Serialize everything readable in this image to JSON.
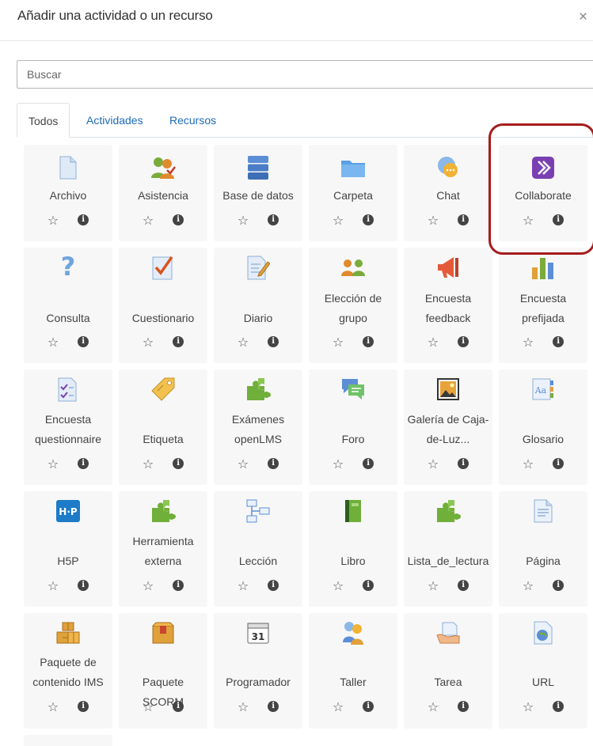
{
  "modal": {
    "title": "Añadir una actividad o un recurso",
    "close": "×"
  },
  "search": {
    "placeholder": "Buscar"
  },
  "tabs": [
    {
      "label": "Todos"
    },
    {
      "label": "Actividades"
    },
    {
      "label": "Recursos"
    }
  ],
  "items": [
    {
      "label": "Archivo",
      "icon": "file-icon"
    },
    {
      "label": "Asistencia",
      "icon": "attendance-icon"
    },
    {
      "label": "Base de datos",
      "icon": "database-icon"
    },
    {
      "label": "Carpeta",
      "icon": "folder-icon"
    },
    {
      "label": "Chat",
      "icon": "chat-icon"
    },
    {
      "label": "Collaborate",
      "icon": "collaborate-icon"
    },
    {
      "label": "Consulta",
      "icon": "question-icon"
    },
    {
      "label": "Cuestionario",
      "icon": "quiz-icon"
    },
    {
      "label": "Diario",
      "icon": "journal-icon"
    },
    {
      "label": "Elección de grupo",
      "icon": "group-choice-icon"
    },
    {
      "label": "Encuesta feedback",
      "icon": "feedback-icon"
    },
    {
      "label": "Encuesta prefijada",
      "icon": "survey-icon"
    },
    {
      "label": "Encuesta questionnaire",
      "icon": "questionnaire-icon"
    },
    {
      "label": "Etiqueta",
      "icon": "label-icon"
    },
    {
      "label": "Exámenes openLMS",
      "icon": "puzzle-icon"
    },
    {
      "label": "Foro",
      "icon": "forum-icon"
    },
    {
      "label": "Galería de Caja-de-Luz...",
      "icon": "gallery-icon"
    },
    {
      "label": "Glosario",
      "icon": "glossary-icon"
    },
    {
      "label": "H5P",
      "icon": "h5p-icon"
    },
    {
      "label": "Herramienta externa",
      "icon": "puzzle-icon"
    },
    {
      "label": "Lección",
      "icon": "lesson-icon"
    },
    {
      "label": "Libro",
      "icon": "book-icon"
    },
    {
      "label": "Lista_de_lectura",
      "icon": "puzzle-icon"
    },
    {
      "label": "Página",
      "icon": "page-icon"
    },
    {
      "label": "Paquete de contenido IMS",
      "icon": "ims-package-icon"
    },
    {
      "label": "Paquete SCORM",
      "icon": "scorm-icon"
    },
    {
      "label": "Programador",
      "icon": "calendar-icon",
      "icon_text": "31"
    },
    {
      "label": "Taller",
      "icon": "workshop-icon"
    },
    {
      "label": "Tarea",
      "icon": "assignment-icon"
    },
    {
      "label": "URL",
      "icon": "url-icon"
    },
    {
      "label": "",
      "icon": "more-icon"
    }
  ],
  "item_actions": {
    "star": "☆",
    "info": "i"
  },
  "highlight_color": "#a51c1c",
  "link_color": "#1e6bb8"
}
